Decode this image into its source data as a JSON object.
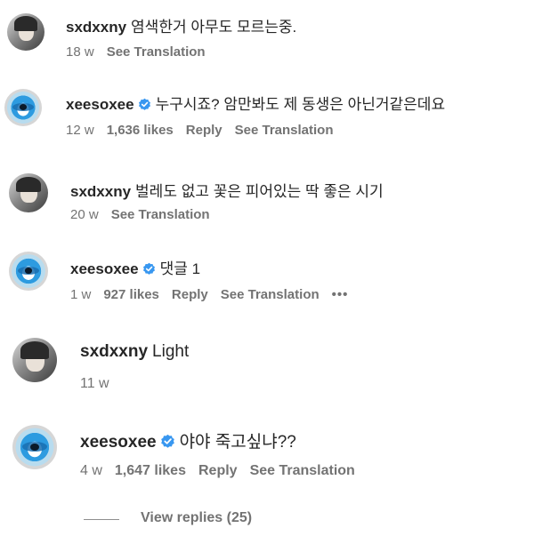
{
  "comments": [
    {
      "username": "sxdxxny",
      "text": "염색한거 아무도 모르는중.",
      "verified": false,
      "time": "18 w",
      "likes": "",
      "reply": "",
      "translate": "See Translation"
    },
    {
      "username": "xeesoxee",
      "text": "누구시죠? 암만봐도 제 동생은 아닌거같은데요",
      "verified": true,
      "time": "12 w",
      "likes": "1,636 likes",
      "reply": "Reply",
      "translate": "See Translation"
    },
    {
      "username": "sxdxxny",
      "text": "벌레도 없고 꽃은 피어있는 딱 좋은 시기",
      "verified": false,
      "time": "20 w",
      "likes": "",
      "reply": "",
      "translate": "See Translation"
    },
    {
      "username": "xeesoxee",
      "text": "댓글 1",
      "verified": true,
      "time": "1 w",
      "likes": "927 likes",
      "reply": "Reply",
      "translate": "See Translation",
      "more": "•••"
    },
    {
      "username": "sxdxxny",
      "text": "Light",
      "verified": false,
      "time": "11 w",
      "likes": "",
      "reply": "",
      "translate": ""
    },
    {
      "username": "xeesoxee",
      "text": "야야 죽고싶냐??",
      "verified": true,
      "time": "4 w",
      "likes": "1,647 likes",
      "reply": "Reply",
      "translate": "See Translation"
    }
  ],
  "view_replies": "View replies (25)",
  "colors": {
    "verified_blue": "#3897f0",
    "text": "#262626",
    "secondary": "#737373"
  }
}
